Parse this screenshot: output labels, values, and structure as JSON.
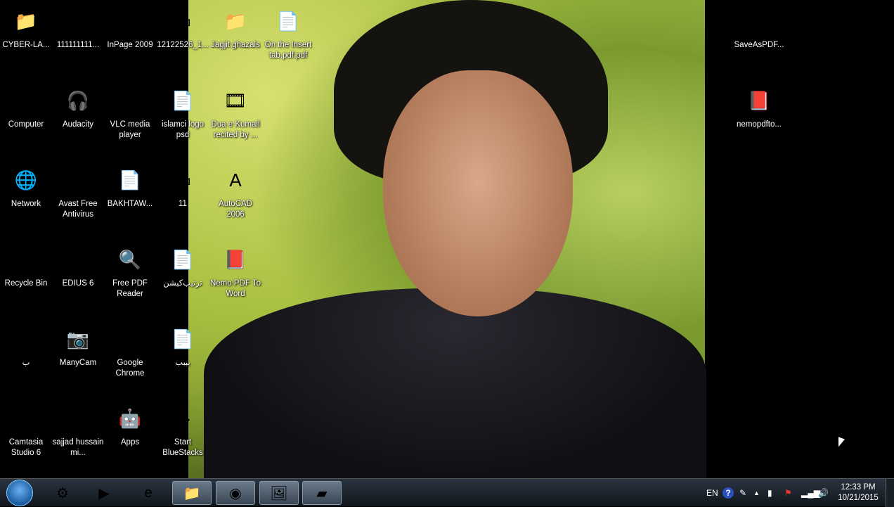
{
  "desktop": {
    "icons": [
      {
        "label": "CYBER-LA...",
        "glyph": "📁",
        "col": 0,
        "row": 0
      },
      {
        "label": "111111111...",
        "glyph": "♪",
        "col": 1,
        "row": 0
      },
      {
        "label": "InPage 2009",
        "glyph": "i",
        "col": 2,
        "row": 0
      },
      {
        "label": "12122526_1...",
        "glyph": "▭",
        "col": 3,
        "row": 0
      },
      {
        "label": "Jagjit ghazals",
        "glyph": "📁",
        "col": 4,
        "row": 0
      },
      {
        "label": "On the Insert tab.pdf.pdf",
        "glyph": "📄",
        "col": 5,
        "row": 0
      },
      {
        "label": "Computer",
        "glyph": "🖥",
        "col": 0,
        "row": 1
      },
      {
        "label": "Audacity",
        "glyph": "🎧",
        "col": 1,
        "row": 1
      },
      {
        "label": "VLC media player",
        "glyph": "▲",
        "col": 2,
        "row": 1
      },
      {
        "label": "islamci logo psd",
        "glyph": "📄",
        "col": 3,
        "row": 1
      },
      {
        "label": "Dua e Kumail recited by ...",
        "glyph": "🎞",
        "col": 4,
        "row": 1
      },
      {
        "label": "Network",
        "glyph": "🌐",
        "col": 0,
        "row": 2
      },
      {
        "label": "Avast Free Antivirus",
        "glyph": "✱",
        "col": 1,
        "row": 2
      },
      {
        "label": "BAKHTAW...",
        "glyph": "📄",
        "col": 2,
        "row": 2
      },
      {
        "label": "11",
        "glyph": "▭",
        "col": 3,
        "row": 2
      },
      {
        "label": "AutoCAD 2006",
        "glyph": "A",
        "col": 4,
        "row": 2
      },
      {
        "label": "Recycle Bin",
        "glyph": "🗑",
        "col": 0,
        "row": 3
      },
      {
        "label": "EDIUS 6",
        "glyph": "▷",
        "col": 1,
        "row": 3
      },
      {
        "label": "Free PDF Reader",
        "glyph": "🔍",
        "col": 2,
        "row": 3
      },
      {
        "label": "ترتیب‌کیشن",
        "glyph": "📄",
        "col": 3,
        "row": 3
      },
      {
        "label": "Nemo PDF To Word",
        "glyph": "📕",
        "col": 4,
        "row": 3
      },
      {
        "label": "ب",
        "glyph": "W",
        "col": 0,
        "row": 4
      },
      {
        "label": "ManyCam",
        "glyph": "📷",
        "col": 1,
        "row": 4
      },
      {
        "label": "Google Chrome",
        "glyph": "◉",
        "col": 2,
        "row": 4
      },
      {
        "label": "بببب",
        "glyph": "📄",
        "col": 3,
        "row": 4
      },
      {
        "label": "Camtasia Studio 6",
        "glyph": "▰",
        "col": 0,
        "row": 5
      },
      {
        "label": "sajjad hussain mi...",
        "glyph": "♪",
        "col": 1,
        "row": 5
      },
      {
        "label": "Apps",
        "glyph": "🤖",
        "col": 2,
        "row": 5
      },
      {
        "label": "Start BlueStacks",
        "glyph": "◆",
        "col": 3,
        "row": 5
      },
      {
        "label": "SaveAsPDF...",
        "glyph": "🖥",
        "col": 6,
        "row": 0
      },
      {
        "label": "nemopdfto...",
        "glyph": "📕",
        "col": 6,
        "row": 1
      }
    ]
  },
  "taskbar": {
    "items": [
      {
        "name": "control-panel",
        "glyph": "⚙",
        "open": false
      },
      {
        "name": "media-player",
        "glyph": "▶",
        "open": false
      },
      {
        "name": "internet-explorer",
        "glyph": "e",
        "open": false
      },
      {
        "name": "windows-explorer",
        "glyph": "📁",
        "open": true
      },
      {
        "name": "google-chrome",
        "glyph": "◉",
        "open": true
      },
      {
        "name": "photo-viewer",
        "glyph": "🖼",
        "open": true
      },
      {
        "name": "camtasia",
        "glyph": "▰",
        "open": true
      }
    ],
    "language": "EN",
    "help": "?",
    "time": "12:33 PM",
    "date": "10/21/2015"
  }
}
